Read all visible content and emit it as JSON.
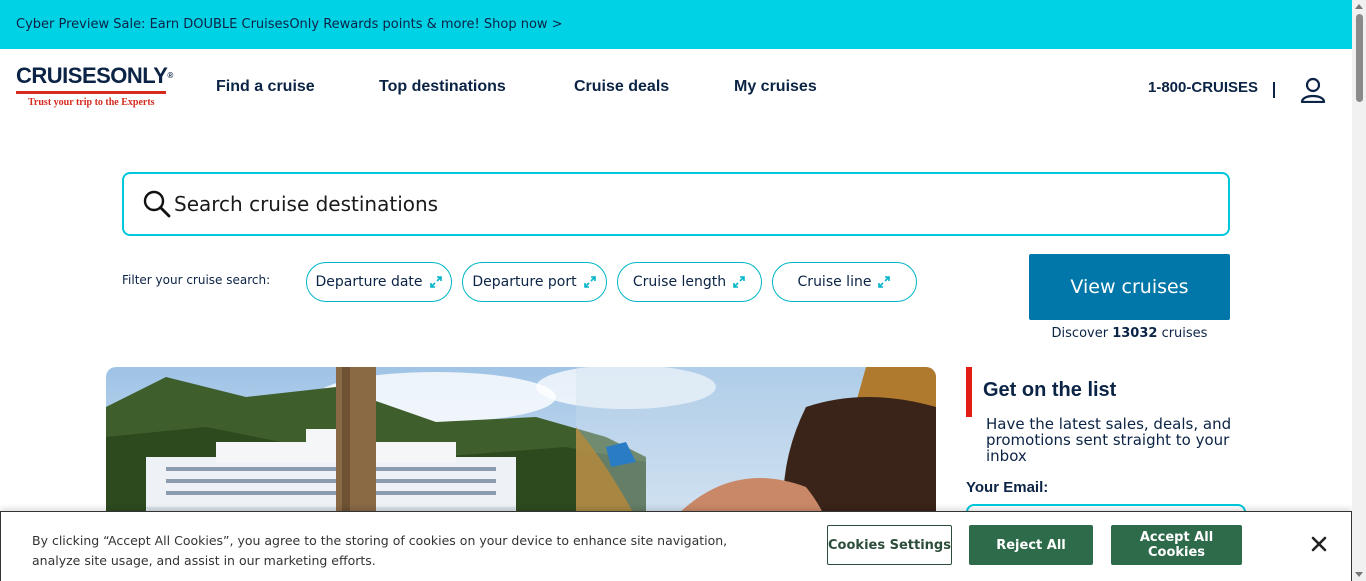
{
  "promo": {
    "text": "Cyber Preview Sale: Earn DOUBLE CruisesOnly Rewards points & more! Shop now >"
  },
  "header": {
    "logo_text": "CRUISESONLY",
    "logo_reg": "®",
    "logo_tagline": "Trust your trip to the Experts",
    "nav": [
      "Find a cruise",
      "Top destinations",
      "Cruise deals",
      "My cruises"
    ],
    "phone": "1-800-CRUISES",
    "account_icon": "user-icon"
  },
  "search": {
    "placeholder": "Search cruise destinations",
    "icon": "search-icon"
  },
  "filters": {
    "label": "Filter your cruise search:",
    "chips": [
      "Departure date",
      "Departure port",
      "Cruise length",
      "Cruise line"
    ],
    "chip_icon": "expand-icon"
  },
  "cta": {
    "button": "View cruises",
    "discover_prefix": "Discover ",
    "discover_count": "13032",
    "discover_suffix": " cruises"
  },
  "newsletter": {
    "title": "Get on the list",
    "subtitle": "Have the latest sales, deals, and promotions sent straight to your inbox",
    "email_label": "Your Email:"
  },
  "cookie": {
    "text": "By clicking “Accept All Cookies”, you agree to the storing of cookies on your device to enhance site navigation, analyze site usage, and assist in our marketing efforts.",
    "settings": "Cookies Settings",
    "reject": "Reject All",
    "accept": "Accept All Cookies",
    "close_icon": "close-icon"
  },
  "colors": {
    "banner": "#00d2e6",
    "navy": "#0b2345",
    "cta": "#0077a8",
    "accent_red": "#e21b13",
    "cookie_green": "#2e6b4b"
  }
}
